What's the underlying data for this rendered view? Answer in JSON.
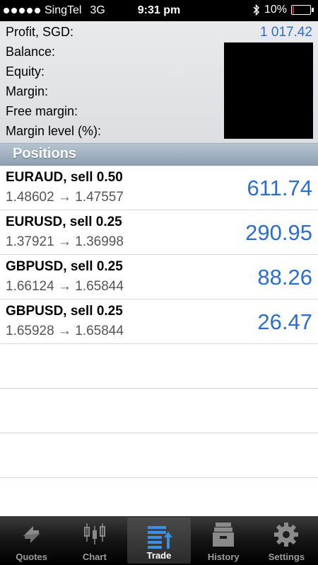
{
  "status": {
    "carrier": "SingTel",
    "network": "3G",
    "time": "9:31 pm",
    "battery": "10%",
    "battery_level": 0.1,
    "bluetooth_icon": "bluetooth-icon"
  },
  "account": {
    "profit_label": "Profit, SGD:",
    "profit_value": "1 017.42",
    "balance_label": "Balance:",
    "equity_label": "Equity:",
    "margin_label": "Margin:",
    "free_margin_label": "Free margin:",
    "margin_level_label": "Margin level (%):"
  },
  "positions": {
    "title": "Positions",
    "items": [
      {
        "title": "EURAUD, sell 0.50",
        "prices": "1.48602 → 1.47557",
        "profit": "611.74"
      },
      {
        "title": "EURUSD, sell 0.25",
        "prices": "1.37921 → 1.36998",
        "profit": "290.95"
      },
      {
        "title": "GBPUSD, sell 0.25",
        "prices": "1.66124 → 1.65844",
        "profit": "88.26"
      },
      {
        "title": "GBPUSD, sell 0.25",
        "prices": "1.65928 → 1.65844",
        "profit": "26.47"
      }
    ]
  },
  "tabs": [
    {
      "label": "Quotes",
      "icon": "quotes-icon",
      "active": false
    },
    {
      "label": "Chart",
      "icon": "chart-icon",
      "active": false
    },
    {
      "label": "Trade",
      "icon": "trade-icon",
      "active": true
    },
    {
      "label": "History",
      "icon": "history-icon",
      "active": false
    },
    {
      "label": "Settings",
      "icon": "gear-icon",
      "active": false
    }
  ],
  "colors": {
    "accent": "#2a6fcf",
    "battery_low": "#e0202a"
  }
}
